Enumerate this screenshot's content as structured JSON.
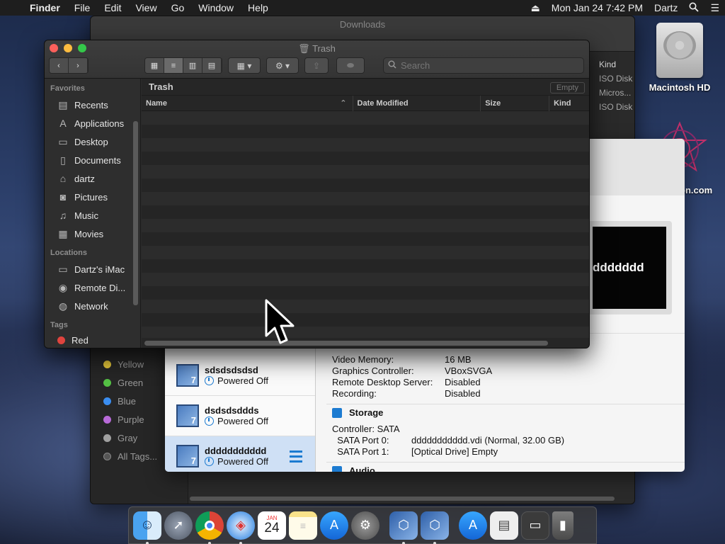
{
  "menubar": {
    "app": "Finder",
    "items": [
      "File",
      "Edit",
      "View",
      "Go",
      "Window",
      "Help"
    ],
    "clock": "Mon Jan 24  7:42 PM",
    "user": "Dartz"
  },
  "desktop": {
    "hd_label": "Macintosh HD",
    "partial_label": "on.com"
  },
  "downloads_window": {
    "title": "Downloads",
    "kind_header": "Kind",
    "kind_values": [
      "ISO Disk",
      "Micros...",
      "ISO Disk"
    ],
    "tags": [
      {
        "label": "Yellow",
        "color": "#e6c73a"
      },
      {
        "label": "Green",
        "color": "#55c245"
      },
      {
        "label": "Blue",
        "color": "#3a8df0"
      },
      {
        "label": "Purple",
        "color": "#b86ad8"
      },
      {
        "label": "Gray",
        "color": "#a0a0a0"
      },
      {
        "label": "All Tags...",
        "color": "#555555"
      }
    ]
  },
  "vbox": {
    "preview_text": "ddddddd",
    "vms": [
      {
        "name": "sdsdsdsdsd",
        "state": "Powered Off",
        "os_badge": "7"
      },
      {
        "name": "dsdsdsddds",
        "state": "Powered Off",
        "os_badge": "7"
      },
      {
        "name": "ddddddddddd",
        "state": "Powered Off",
        "os_badge": "7"
      }
    ],
    "display": [
      {
        "k": "Video Memory:",
        "v": "16 MB"
      },
      {
        "k": "Graphics Controller:",
        "v": "VBoxSVGA"
      },
      {
        "k": "Remote Desktop Server:",
        "v": "Disabled"
      },
      {
        "k": "Recording:",
        "v": "Disabled"
      }
    ],
    "storage_title": "Storage",
    "storage": [
      {
        "k": "Controller: SATA",
        "v": ""
      },
      {
        "k": "  SATA Port 0:",
        "v": "ddddddddddd.vdi (Normal, 32.00 GB)"
      },
      {
        "k": "  SATA Port 1:",
        "v": "[Optical Drive] Empty"
      }
    ],
    "audio_title": "Audio"
  },
  "trash_window": {
    "title": "Trash",
    "search_placeholder": "Search",
    "path_label": "Trash",
    "empty_button": "Empty",
    "columns": [
      "Name",
      "Date Modified",
      "Size",
      "Kind"
    ],
    "favorites_header": "Favorites",
    "favorites": [
      {
        "label": "Recents",
        "icon": "clock-icon"
      },
      {
        "label": "Applications",
        "icon": "applications-icon"
      },
      {
        "label": "Desktop",
        "icon": "desktop-icon"
      },
      {
        "label": "Documents",
        "icon": "documents-icon"
      },
      {
        "label": "dartz",
        "icon": "home-icon"
      },
      {
        "label": "Pictures",
        "icon": "camera-icon"
      },
      {
        "label": "Music",
        "icon": "music-icon"
      },
      {
        "label": "Movies",
        "icon": "film-icon"
      }
    ],
    "locations_header": "Locations",
    "locations": [
      {
        "label": "Dartz's iMac",
        "icon": "imac-icon"
      },
      {
        "label": "Remote Di...",
        "icon": "disc-icon"
      },
      {
        "label": "Network",
        "icon": "globe-icon"
      }
    ],
    "tags_header": "Tags",
    "first_tag": {
      "label": "Red",
      "color": "#e0443e"
    }
  },
  "dock": {
    "calendar_month": "JAN",
    "calendar_day": "24"
  }
}
